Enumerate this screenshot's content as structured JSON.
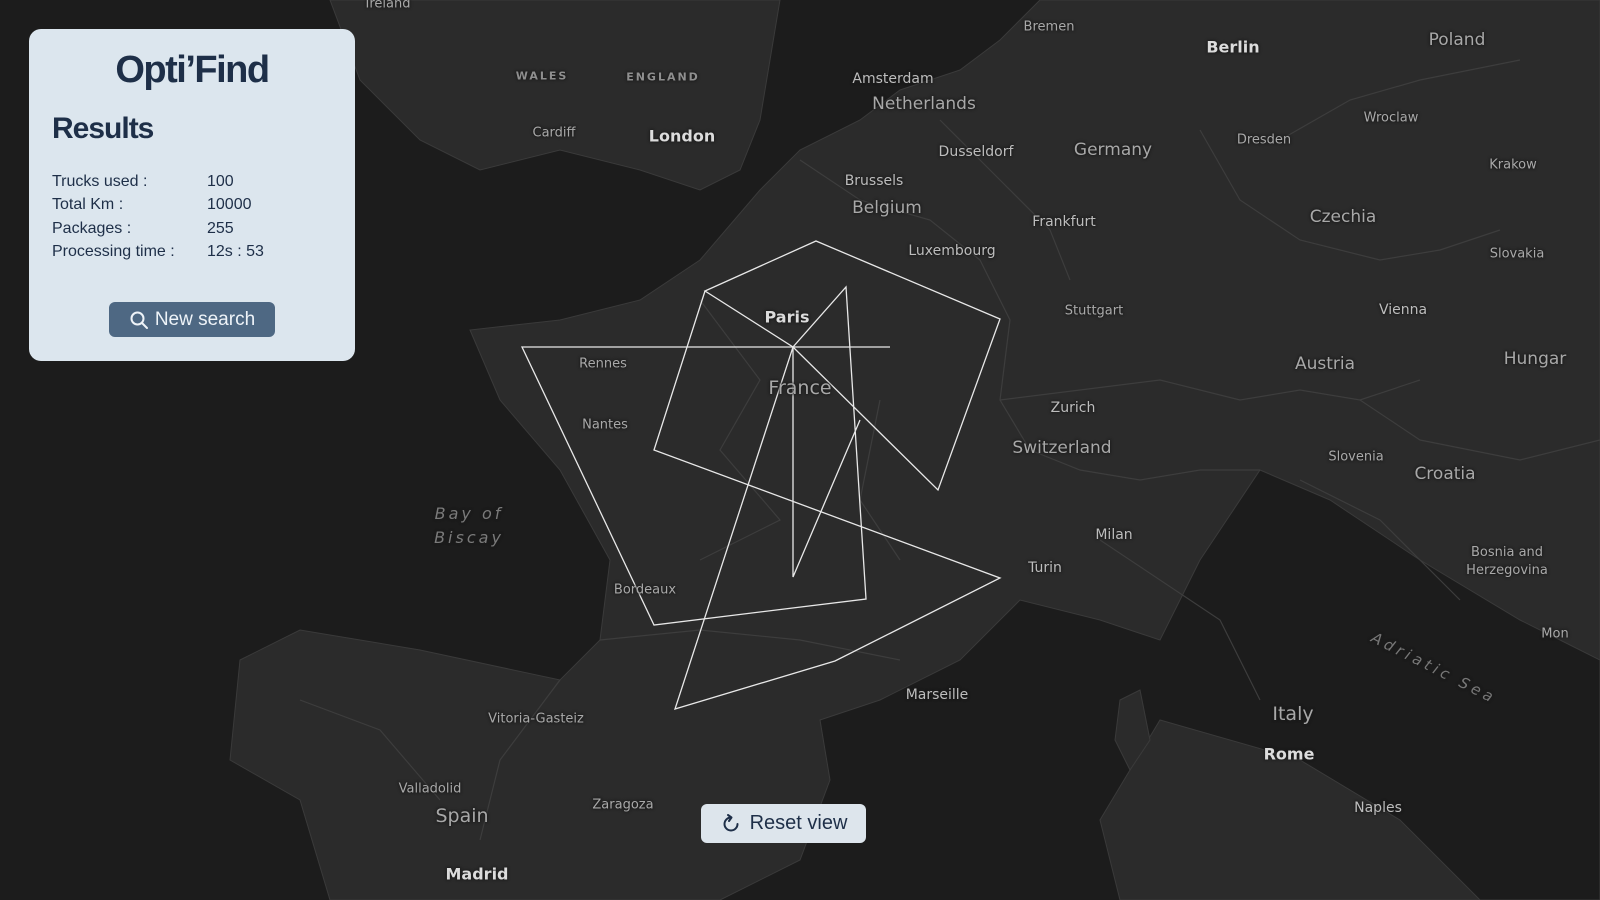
{
  "app": {
    "title": "Opti’Find"
  },
  "results": {
    "heading": "Results",
    "stats": [
      {
        "label": "Trucks used :",
        "value": "100"
      },
      {
        "label": "Total Km :",
        "value": "10000"
      },
      {
        "label": "Packages :",
        "value": "255"
      },
      {
        "label": "Processing time :",
        "value": "12s : 53"
      }
    ],
    "new_search_label": "New search",
    "new_search_icon": "search-icon"
  },
  "reset_view": {
    "label": "Reset view",
    "icon": "refresh-icon"
  },
  "map": {
    "countries": [
      "Netherlands",
      "Germany",
      "Belgium",
      "France",
      "Switzerland",
      "Austria",
      "Czechia",
      "Slovakia",
      "Slovenia",
      "Croatia",
      "Bosnia and Herzegovina",
      "Italy",
      "Spain",
      "Poland",
      "Hungar"
    ],
    "cities": [
      "London",
      "Paris",
      "Berlin",
      "Amsterdam",
      "Brussels",
      "Luxembourg",
      "Frankfurt",
      "Dusseldorf",
      "Bremen",
      "Stuttgart",
      "Zurich",
      "Milan",
      "Turin",
      "Marseille",
      "Rome",
      "Naples",
      "Madrid",
      "Cardiff",
      "Rennes",
      "Nantes",
      "Bordeaux",
      "Vitoria-Gasteiz",
      "Valladolid",
      "Zaragoza",
      "Vienna",
      "Dresden",
      "Wroclaw",
      "Krakow",
      "Mon",
      "Ireland"
    ],
    "regions": [
      "WALES",
      "ENGLAND"
    ],
    "seas": [
      "Bay of Biscay",
      "Adriatic Sea"
    ],
    "route_color": "#e8e8e8"
  }
}
